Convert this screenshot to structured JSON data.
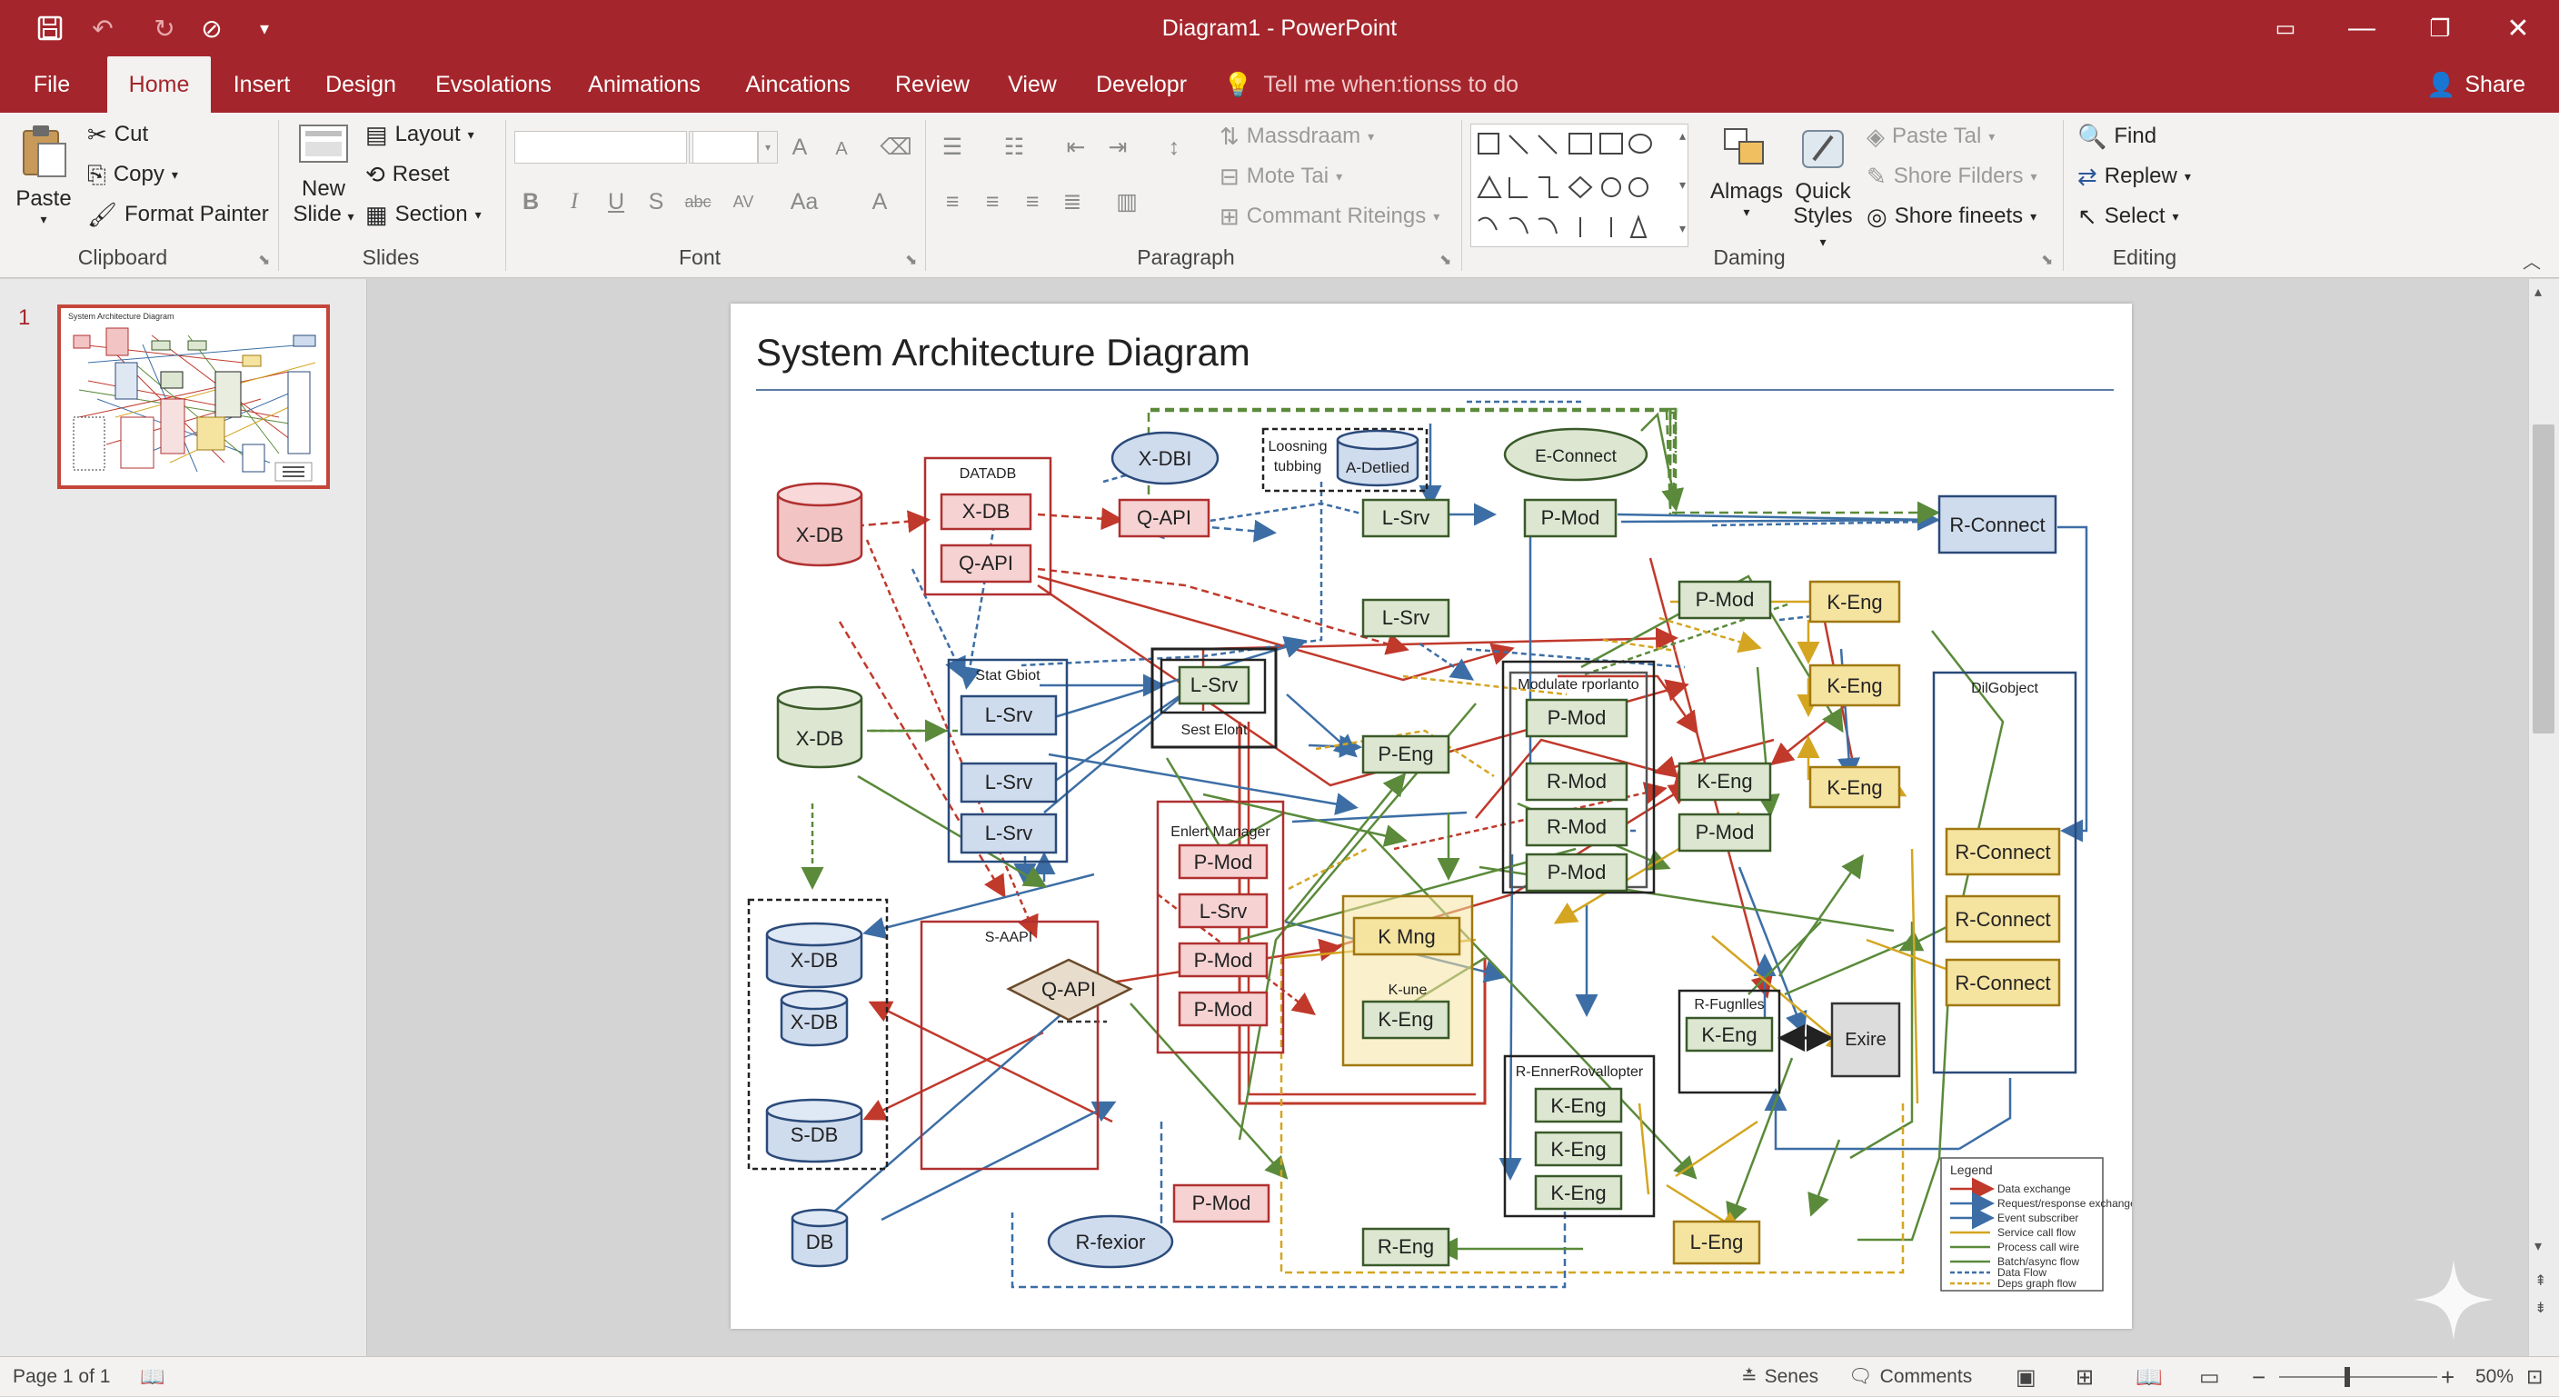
{
  "window": {
    "title": "Diagram1 - PowerPoint"
  },
  "tabs": [
    {
      "label": "File"
    },
    {
      "label": "Home"
    },
    {
      "label": "Insert"
    },
    {
      "label": "Design"
    },
    {
      "label": "Evsolations"
    },
    {
      "label": "Animations"
    },
    {
      "label": "Aincations"
    },
    {
      "label": "Review"
    },
    {
      "label": "View"
    },
    {
      "label": "Developr"
    }
  ],
  "tell_me": "Tell me when:tionss to do",
  "share": "Share",
  "ribbon": {
    "clipboard": {
      "label": "Clipboard",
      "paste": "Paste",
      "cut": "Cut",
      "copy": "Copy",
      "format_painter": "Format Painter"
    },
    "slides": {
      "label": "Slides",
      "new_slide_1": "New",
      "new_slide_2": "Slide",
      "layout": "Layout",
      "reset": "Reset",
      "section": "Section"
    },
    "font": {
      "label": "Font",
      "bold": "B",
      "italic": "I",
      "underline": "U",
      "strike": "S",
      "case": "Aa",
      "grow": "A",
      "shrink": "A",
      "color": "A"
    },
    "paragraph": {
      "label": "Paragraph",
      "massdraam": "Massdraam",
      "mote_tai": "Mote Tai",
      "commant": "Commant Riteings"
    },
    "drawing": {
      "label": "Daming",
      "almags": "Almags",
      "quick_styles_1": "Quick",
      "quick_styles_2": "Styles",
      "paste_tal": "Paste Tal",
      "shore_filders": "Shore Filders",
      "shore_fineets": "Shore fineets"
    },
    "editing": {
      "label": "Editing",
      "find": "Find",
      "replew": "Replew",
      "select": "Select"
    }
  },
  "thumbnail": {
    "number": "1",
    "title": "System Architecture Diagram"
  },
  "slide": {
    "title": "System Architecture Diagram",
    "groups": {
      "datadb": "DATADB",
      "stat_gbiot": "Stat Gbiot",
      "sest_elont": "Sest Elont",
      "enlert_manager": "Enlert Manager",
      "s_aapi": "S-AAPI",
      "modulate": "Modulate rporlanto",
      "k_une": "K-une",
      "r_enner": "R-EnnerRovallopter",
      "r_fugnlles": "R-Fugnlles",
      "dilgobject": "DilGobject",
      "loosening_1": "Loosning",
      "loosening_2": "tubbing",
      "a_detlied": "A-Detlied"
    },
    "nodes": {
      "xdb_red": "X-DB",
      "xdb_green": "X-DB",
      "xdb1": "X-DB",
      "xdb2": "X-DB",
      "s2db": "S-DB",
      "db": "DB",
      "dd_xdb": "X-DB",
      "dd_qapi": "Q-API",
      "qapi_top": "Q-API",
      "xdbi": "X-DBI",
      "e_connect": "E-Connect",
      "lsrv_top": "L-Srv",
      "pmod_top": "P-Mod",
      "r_connect_top": "R-Connect",
      "lsrv_mid": "L-Srv",
      "pmod_r1": "P-Mod",
      "keng_r1": "K-Eng",
      "keng_r2": "K-Eng",
      "keng_r3": "K-Eng",
      "sg_lsrv1": "L-Srv",
      "sg_lsrv2": "L-Srv",
      "sg_lsrv3": "L-Srv",
      "se_lsrv": "L-Srv",
      "peng": "P-Eng",
      "mod_pmod1": "P-Mod",
      "mod_rmod1": "R-Mod",
      "mod_rmod2": "R-Mod",
      "mod_pmod2": "P-Mod",
      "keng_m": "K-Eng",
      "pmod_m": "P-Mod",
      "em_pmod1": "P-Mod",
      "em_lsrv": "L-Srv",
      "em_pmod2": "P-Mod",
      "em_pmod3": "P-Mod",
      "kmng": "K Mng",
      "kune_keng": "K-Eng",
      "qapi_diamond": "Q-API",
      "ren_keng1": "K-Eng",
      "ren_keng2": "K-Eng",
      "ren_keng3": "K-Eng",
      "rf_keng": "K-Eng",
      "exire": "Exire",
      "rc1": "R-Connect",
      "rc2": "R-Connect",
      "rc3": "R-Connect",
      "pmod_bottom": "P-Mod",
      "r_fexior": "R-fexior",
      "r_eng": "R-Eng",
      "l_eng": "L-Eng"
    },
    "legend": {
      "title": "Legend",
      "items": [
        "Data exchange",
        "Request/response exchange",
        "Event subscriber",
        "Service call flow",
        "Process call wire",
        "Batch/async flow",
        "Data Flow",
        "Deps graph flow"
      ]
    }
  },
  "status": {
    "page": "Page 1 of 1",
    "notes": "Senes",
    "comments": "Comments",
    "zoom": "50%"
  },
  "colors": {
    "accent": "#a4262c",
    "red": "#c0392b",
    "blue": "#3c6ea5",
    "green": "#5a8a3a",
    "yellow": "#d4a520",
    "dark": "#333333"
  }
}
